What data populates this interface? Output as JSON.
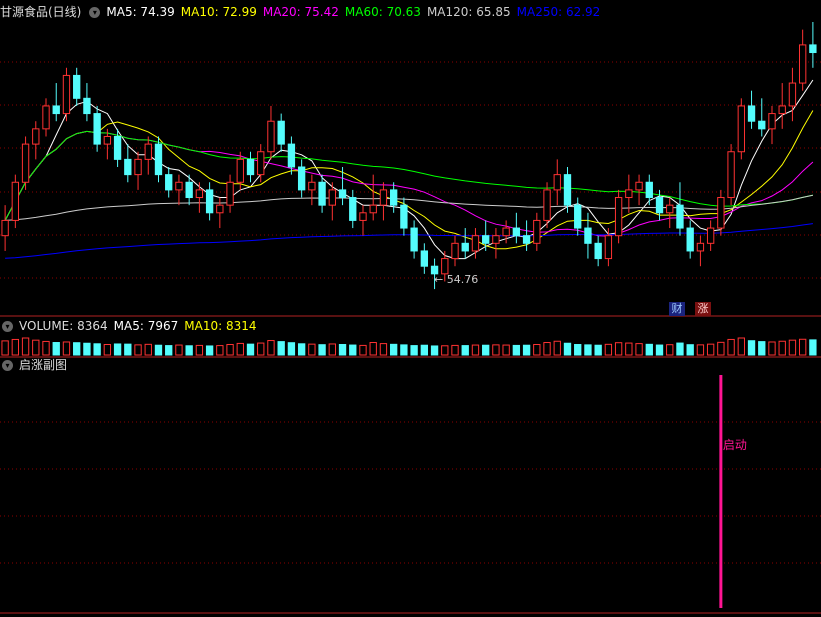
{
  "main_header": {
    "title": "甘源食品(日线)",
    "ma5": "MA5: 74.39",
    "ma10": "MA10: 72.99",
    "ma20": "MA20: 75.42",
    "ma60": "MA60: 70.63",
    "ma120": "MA120: 65.85",
    "ma250": "MA250: 62.92"
  },
  "vol_header": {
    "volume": "VOLUME: 8364",
    "ma5": "MA5: 7967",
    "ma10": "MA10: 8314"
  },
  "sub_header": {
    "title": "启涨副图"
  },
  "badges": {
    "cai": "财",
    "zhang": "涨"
  },
  "annotation": {
    "low_label": "54.76",
    "signal_label": "启动"
  },
  "colors": {
    "ma5": "#ffffff",
    "ma10": "#ffff00",
    "ma20": "#ff00ff",
    "ma60": "#00ff00",
    "ma120": "#cccccc",
    "ma250": "#0000ff",
    "up": "#ff3232",
    "down": "#54fcfc",
    "grid": "#8b0000",
    "signal": "#ff1493"
  },
  "chart_data": {
    "type": "candlestick",
    "price_range": [
      52,
      90
    ],
    "low_marker": 54.76,
    "signal_index": 70,
    "candles": [
      [
        62,
        66,
        60,
        64
      ],
      [
        64,
        70,
        63,
        69
      ],
      [
        69,
        75,
        68,
        74
      ],
      [
        74,
        77,
        72,
        76
      ],
      [
        76,
        80,
        75,
        79
      ],
      [
        79,
        82,
        77,
        78
      ],
      [
        78,
        84,
        77,
        83
      ],
      [
        83,
        84,
        79,
        80
      ],
      [
        80,
        82,
        77,
        78
      ],
      [
        78,
        79,
        73,
        74
      ],
      [
        74,
        76,
        72,
        75
      ],
      [
        75,
        76,
        71,
        72
      ],
      [
        72,
        74,
        69,
        70
      ],
      [
        70,
        73,
        68,
        72
      ],
      [
        72,
        75,
        70,
        74
      ],
      [
        74,
        75,
        69,
        70
      ],
      [
        70,
        71,
        67,
        68
      ],
      [
        68,
        70,
        66,
        69
      ],
      [
        69,
        70,
        66,
        67
      ],
      [
        67,
        69,
        65,
        68
      ],
      [
        68,
        69,
        64,
        65
      ],
      [
        65,
        67,
        63,
        66
      ],
      [
        66,
        70,
        65,
        69
      ],
      [
        69,
        73,
        68,
        72
      ],
      [
        72,
        73,
        69,
        70
      ],
      [
        70,
        74,
        69,
        73
      ],
      [
        73,
        79,
        72,
        77
      ],
      [
        77,
        78,
        73,
        74
      ],
      [
        74,
        75,
        70,
        71
      ],
      [
        71,
        72,
        67,
        68
      ],
      [
        68,
        70,
        66,
        69
      ],
      [
        69,
        70,
        65,
        66
      ],
      [
        66,
        69,
        64,
        68
      ],
      [
        68,
        71,
        66,
        67
      ],
      [
        67,
        68,
        63,
        64
      ],
      [
        64,
        66,
        62,
        65
      ],
      [
        65,
        70,
        64,
        66
      ],
      [
        66,
        69,
        64,
        68
      ],
      [
        68,
        69,
        65,
        66
      ],
      [
        66,
        67,
        62,
        63
      ],
      [
        63,
        64,
        59,
        60
      ],
      [
        60,
        61,
        57,
        58
      ],
      [
        58,
        59,
        55,
        57
      ],
      [
        57,
        60,
        56,
        59
      ],
      [
        59,
        62,
        58,
        61
      ],
      [
        61,
        63,
        59,
        60
      ],
      [
        60,
        63,
        59,
        62
      ],
      [
        62,
        64,
        60,
        61
      ],
      [
        61,
        63,
        59,
        62
      ],
      [
        62,
        64,
        61,
        63
      ],
      [
        63,
        65,
        61,
        62
      ],
      [
        62,
        64,
        60,
        61
      ],
      [
        61,
        65,
        60,
        64
      ],
      [
        64,
        69,
        63,
        68
      ],
      [
        68,
        72,
        66,
        70
      ],
      [
        70,
        71,
        65,
        66
      ],
      [
        66,
        67,
        62,
        63
      ],
      [
        63,
        65,
        59,
        61
      ],
      [
        61,
        62,
        58,
        59
      ],
      [
        59,
        63,
        58,
        62
      ],
      [
        62,
        68,
        61,
        67
      ],
      [
        67,
        70,
        65,
        68
      ],
      [
        68,
        70,
        66,
        69
      ],
      [
        69,
        70,
        66,
        67
      ],
      [
        67,
        68,
        64,
        65
      ],
      [
        65,
        67,
        63,
        66
      ],
      [
        66,
        69,
        62,
        63
      ],
      [
        63,
        64,
        59,
        60
      ],
      [
        60,
        62,
        58,
        61
      ],
      [
        61,
        64,
        60,
        63
      ],
      [
        63,
        68,
        62,
        67
      ],
      [
        67,
        74,
        66,
        73
      ],
      [
        73,
        80,
        72,
        79
      ],
      [
        79,
        81,
        76,
        77
      ],
      [
        77,
        80,
        75,
        76
      ],
      [
        76,
        79,
        74,
        78
      ],
      [
        78,
        82,
        76,
        79
      ],
      [
        79,
        84,
        77,
        82
      ],
      [
        82,
        89,
        81,
        87
      ],
      [
        87,
        90,
        84,
        86
      ]
    ],
    "volumes": [
      7800,
      8600,
      9400,
      8200,
      7500,
      6900,
      7200,
      6800,
      6500,
      6200,
      5800,
      6100,
      6000,
      5600,
      5900,
      5400,
      5200,
      5500,
      5100,
      5300,
      5000,
      5200,
      5800,
      6400,
      6000,
      6600,
      8000,
      7400,
      6800,
      6200,
      6000,
      5700,
      6100,
      5800,
      5500,
      5300,
      6900,
      6300,
      5900,
      5600,
      5200,
      5400,
      5000,
      5100,
      5300,
      5200,
      5500,
      5400,
      5600,
      5500,
      5300,
      5400,
      5800,
      6900,
      7600,
      6500,
      5800,
      5600,
      5400,
      5900,
      6800,
      6600,
      6300,
      5900,
      5500,
      5700,
      6600,
      5700,
      5600,
      6000,
      7000,
      8600,
      9400,
      7900,
      7400,
      7200,
      7600,
      8200,
      8700,
      8364
    ]
  }
}
